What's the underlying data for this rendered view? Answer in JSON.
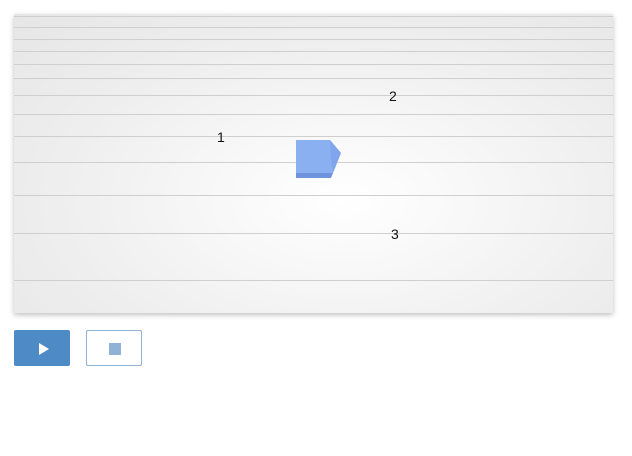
{
  "scene": {
    "markers": [
      {
        "id": "1",
        "text": "1"
      },
      {
        "id": "2",
        "text": "2"
      },
      {
        "id": "3",
        "text": "3"
      }
    ]
  },
  "controls": {
    "play_icon": "play-icon",
    "stop_icon": "stop-icon"
  },
  "colors": {
    "accent": "#4e8ac6",
    "cube": "#8ab0f2"
  }
}
